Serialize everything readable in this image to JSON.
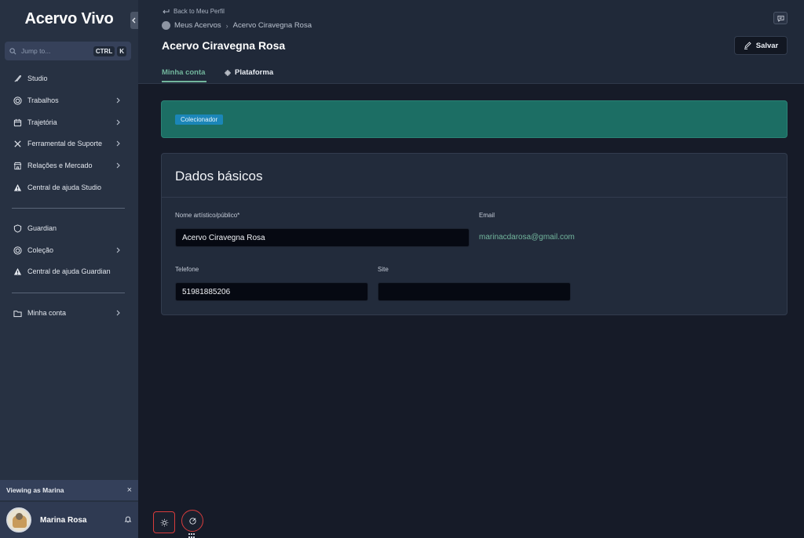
{
  "app": {
    "name": "Acervo Vivo"
  },
  "search": {
    "placeholder": "Jump to...",
    "key1": "CTRL",
    "key2": "K"
  },
  "sidebar": {
    "items": [
      {
        "label": "Studio",
        "icon": "brush-icon"
      },
      {
        "label": "Trabalhos",
        "icon": "target-icon"
      },
      {
        "label": "Trajetória",
        "icon": "calendar-icon"
      },
      {
        "label": "Ferramental de Suporte",
        "icon": "tools-icon"
      },
      {
        "label": "Relações e Mercado",
        "icon": "store-icon"
      },
      {
        "label": "Central de ajuda Studio",
        "icon": "warning-icon"
      },
      {
        "label": "Guardian",
        "icon": "shield-icon"
      },
      {
        "label": "Coleção",
        "icon": "target-icon"
      },
      {
        "label": "Central de ajuda Guardian",
        "icon": "warning-icon"
      },
      {
        "label": "Minha conta",
        "icon": "folder-icon"
      }
    ]
  },
  "viewing": {
    "text": "Viewing as Marina",
    "close": "×"
  },
  "user": {
    "name": "Marina Rosa"
  },
  "header": {
    "back": "Back to Meu Perfil",
    "breadcrumb": [
      "Meus Acervos",
      "Acervo Ciravegna Rosa"
    ],
    "title": "Acervo Ciravegna Rosa",
    "save_label": "Salvar",
    "tabs": [
      {
        "label": "Minha conta",
        "active": true
      },
      {
        "label": "Plataforma",
        "active": false
      }
    ]
  },
  "banner": {
    "badge": "Colecionador"
  },
  "card": {
    "title": "Dados básicos",
    "fields": {
      "name_label": "Nome artístico/público*",
      "name_value": "Acervo Ciravegna Rosa",
      "email_label": "Email",
      "email_value": "marinacdarosa@gmail.com",
      "phone_label": "Telefone",
      "phone_value": "51981885206",
      "site_label": "Site",
      "site_value": ""
    }
  },
  "colors": {
    "accent": "#72b69d",
    "banner": "#1c6e64",
    "badge": "#1b86b8",
    "sidebar": "#273142",
    "background": "#161b28"
  }
}
